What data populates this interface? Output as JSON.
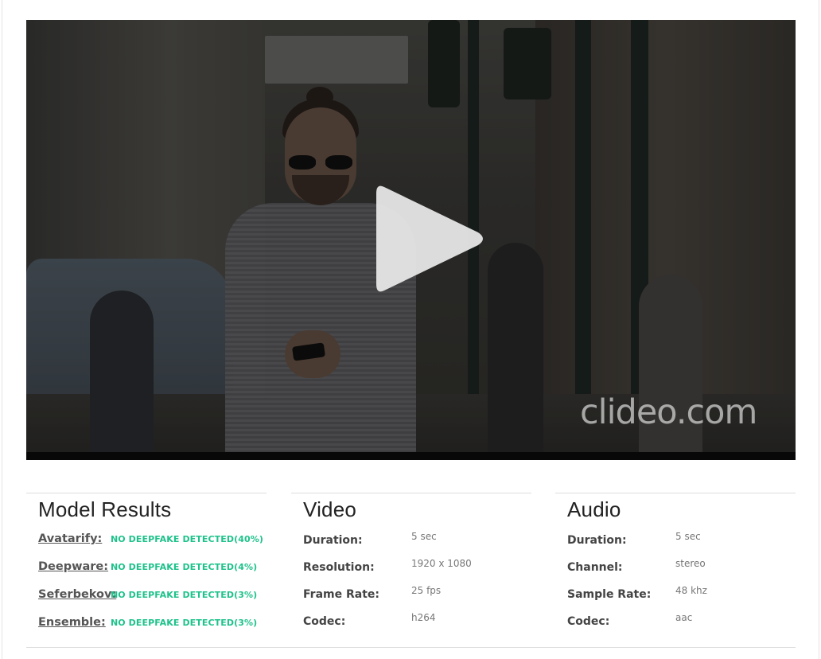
{
  "player": {
    "watermark": "clideo.com"
  },
  "model_results": {
    "title": "Model Results",
    "rows": [
      {
        "model": "Avatarify:",
        "result": "NO DEEPFAKE DETECTED(40%)"
      },
      {
        "model": "Deepware:",
        "result": "NO DEEPFAKE DETECTED(4%)"
      },
      {
        "model": "Seferbekov:",
        "result": "NO DEEPFAKE DETECTED(3%)"
      },
      {
        "model": "Ensemble:",
        "result": "NO DEEPFAKE DETECTED(3%)"
      }
    ],
    "result_color": "#1ec28b"
  },
  "video": {
    "title": "Video",
    "rows": [
      {
        "label": "Duration:",
        "value": "5 sec"
      },
      {
        "label": "Resolution:",
        "value": "1920 x 1080"
      },
      {
        "label": "Frame Rate:",
        "value": "25 fps"
      },
      {
        "label": "Codec:",
        "value": "h264"
      }
    ]
  },
  "audio": {
    "title": "Audio",
    "rows": [
      {
        "label": "Duration:",
        "value": "5 sec"
      },
      {
        "label": "Channel:",
        "value": "stereo"
      },
      {
        "label": "Sample Rate:",
        "value": "48 khz"
      },
      {
        "label": "Codec:",
        "value": "aac"
      }
    ]
  },
  "icons": {
    "play": "play-icon"
  }
}
